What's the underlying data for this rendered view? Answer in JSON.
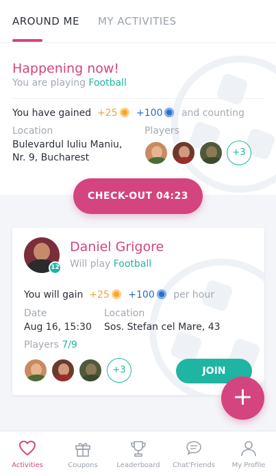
{
  "tabs": {
    "around_me": "AROUND ME",
    "my_activities": "MY ACTIVITIES"
  },
  "current": {
    "title": "Happening now!",
    "playing_prefix": "You are playing",
    "sport": "Football",
    "gain_prefix": "You have gained",
    "coins": "+25",
    "points": "+100",
    "gain_suffix": "and counting",
    "location_label": "Location",
    "location_line1": "Bulevardul Iuliu Maniu,",
    "location_line2": "Nr. 9, Bucharest",
    "players_label": "Players",
    "more_players": "+3",
    "checkout_label": "CHECK-OUT 04:23"
  },
  "activity": {
    "host_name": "Daniel Grigore",
    "host_level": "12",
    "will_prefix": "Will play",
    "sport": "Football",
    "gain_prefix": "You will gain",
    "coins": "+25",
    "points": "+100",
    "gain_suffix": "per hour",
    "date_label": "Date",
    "date_value": "Aug 16, 15:30",
    "location_label": "Location",
    "location_value": "Sos. Stefan cel Mare, 43",
    "players_label": "Players",
    "players_count": "7/9",
    "more_players": "+3",
    "join_label": "JOIN"
  },
  "fab": {
    "label": "+"
  },
  "nav": [
    {
      "label": "Activities",
      "icon": "heart-icon"
    },
    {
      "label": "Coupons",
      "icon": "gift-icon"
    },
    {
      "label": "Leaderboard",
      "icon": "trophy-icon"
    },
    {
      "label": "Chat'Friends",
      "icon": "chat-icon"
    },
    {
      "label": "My Profile",
      "icon": "person-icon"
    }
  ],
  "colors": {
    "accent": "#d4447f",
    "teal": "#1fb5a3",
    "coin": "#f3a33b",
    "points": "#2d6cc7"
  }
}
